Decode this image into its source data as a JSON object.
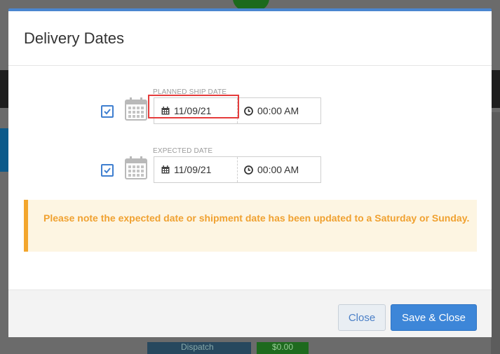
{
  "modal": {
    "title": "Delivery Dates"
  },
  "planned": {
    "label": "PLANNED SHIP DATE",
    "checked": true,
    "date": "11/09/21",
    "time": "00:00 AM"
  },
  "expected": {
    "label": "EXPECTED DATE",
    "checked": true,
    "date": "11/09/21",
    "time": "00:00 AM"
  },
  "alert": {
    "text": "Please note the expected date or shipment date has been updated to a Saturday or Sunday."
  },
  "footer": {
    "close_label": "Close",
    "save_label": "Save & Close"
  },
  "background": {
    "dispatch_label": "Dispatch",
    "amount_label": "$0.00"
  },
  "colors": {
    "accent": "#3d86d8",
    "alert_text": "#f0a130",
    "alert_bg": "#fdf5e2",
    "highlight": "#e53c3c"
  },
  "icons": {
    "calendar_large": "calendar-icon",
    "calendar_small": "calendar-small-icon",
    "clock": "clock-icon",
    "check": "check-icon"
  }
}
